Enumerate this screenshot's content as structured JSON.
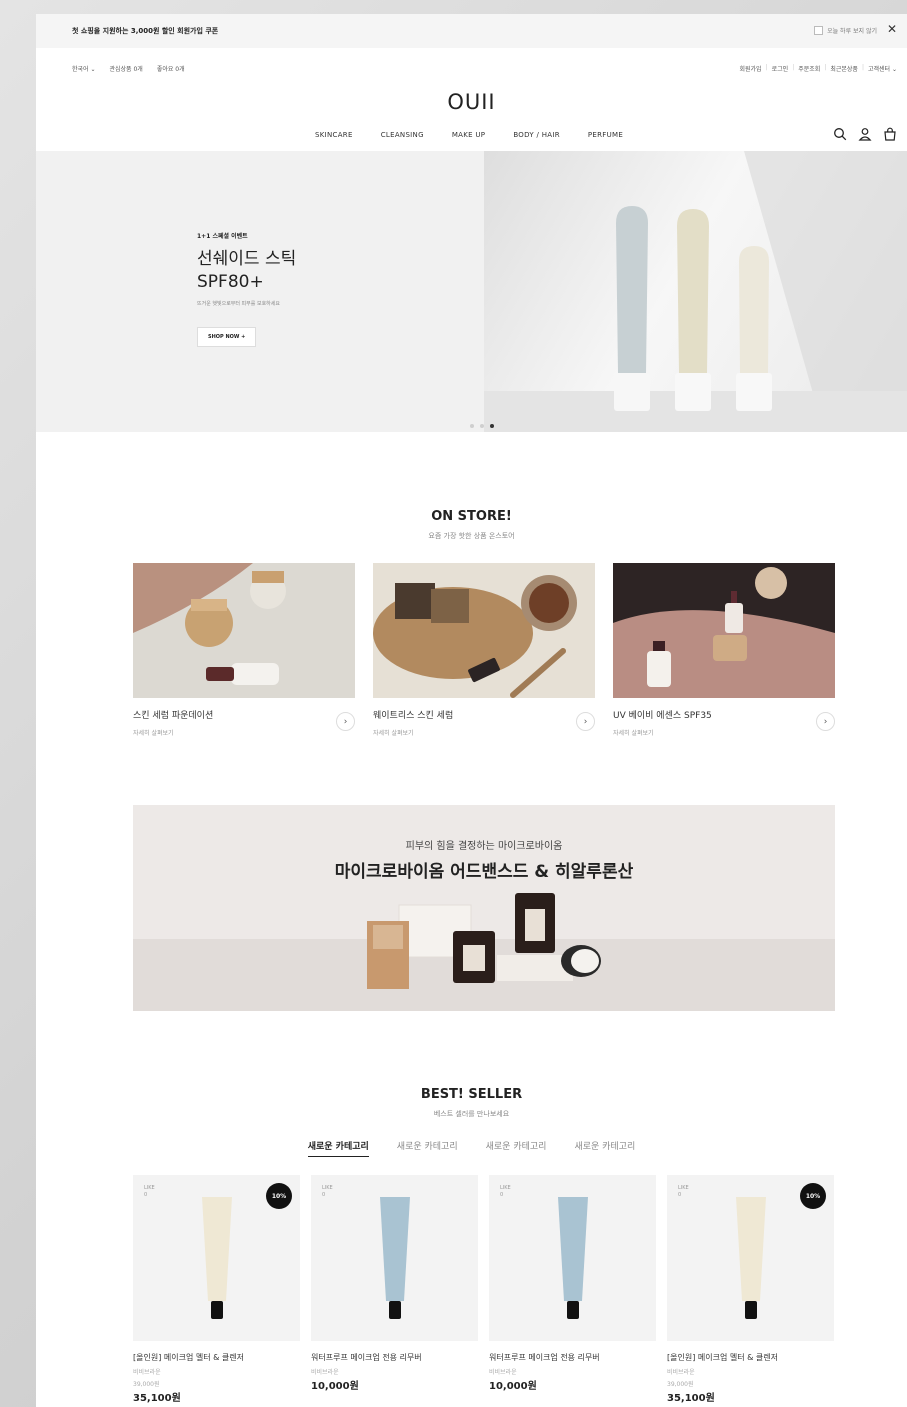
{
  "topbar": {
    "promo": "첫 쇼핑을 지원하는 3,000원 할인 회원가입 쿠폰",
    "hide_today": "오늘 하루 보지 않기",
    "close_icon": "close-icon"
  },
  "util": {
    "language": "한국어 ⌄",
    "wishlist": "관심상품 0개",
    "likes": "좋아요 0개",
    "links": [
      "회원가입",
      "로그인",
      "주문조회",
      "최근본상품",
      "고객센터 ⌄"
    ]
  },
  "logo": "OUII",
  "nav": {
    "menu": [
      "SKINCARE",
      "CLEANSING",
      "MAKE UP",
      "BODY / HAIR",
      "PERFUME"
    ],
    "icons": [
      "search-icon",
      "user-icon",
      "cart-icon"
    ]
  },
  "hero": {
    "tag": "1+1 스페셜 이벤트",
    "title_line1": "선쉐이드 스틱",
    "title_line2": "SPF80+",
    "subtitle": "뜨거운 햇빛으로부터 피부를 보호하세요",
    "button": "SHOP NOW +",
    "slides_total": 3,
    "active_slide": 3
  },
  "on_store": {
    "title": "ON STORE!",
    "subtitle": "요즘 가장 핫한 상품 온스토어",
    "items": [
      {
        "name": "스킨 세럼 파운데이션",
        "more": "자세히 살펴보기"
      },
      {
        "name": "웨이트리스 스킨 세럼",
        "more": "자세히 살펴보기"
      },
      {
        "name": "UV 베이비 에센스 SPF35",
        "more": "자세히 살펴보기"
      }
    ]
  },
  "banner": {
    "subtitle": "피부의 힘을 결정하는 마이크로바이옴",
    "title": "마이크로바이옴 어드밴스드 & 히알루론산"
  },
  "best_seller": {
    "title": "BEST! SELLER",
    "subtitle": "베스트 셀러를 만나보세요",
    "tabs": [
      "새로운 카테고리",
      "새로운 카테고리",
      "새로운 카테고리",
      "새로운 카테고리"
    ],
    "active_tab": 0,
    "products": [
      {
        "like": "LIKE",
        "like_count": "0",
        "badge": "10%",
        "name": "[올인원] 메이크업 멜터 & 클렌저",
        "brand": "비비브라운",
        "original_price": "39,000원",
        "price": "35,100원",
        "tube_color": "#efe8d4"
      },
      {
        "like": "LIKE",
        "like_count": "0",
        "badge": "",
        "name": "워터프루프 메이크업 전용 리무버",
        "brand": "비비브라운",
        "original_price": "",
        "price": "10,000원",
        "tube_color": "#a9c3d2"
      },
      {
        "like": "LIKE",
        "like_count": "0",
        "badge": "",
        "name": "워터프루프 메이크업 전용 리무버",
        "brand": "비비브라운",
        "original_price": "",
        "price": "10,000원",
        "tube_color": "#a9c3d2"
      },
      {
        "like": "LIKE",
        "like_count": "0",
        "badge": "10%",
        "name": "[올인원] 메이크업 멜터 & 클렌저",
        "brand": "비비브라운",
        "original_price": "39,000원",
        "price": "35,100원",
        "tube_color": "#efe8d4"
      }
    ]
  }
}
